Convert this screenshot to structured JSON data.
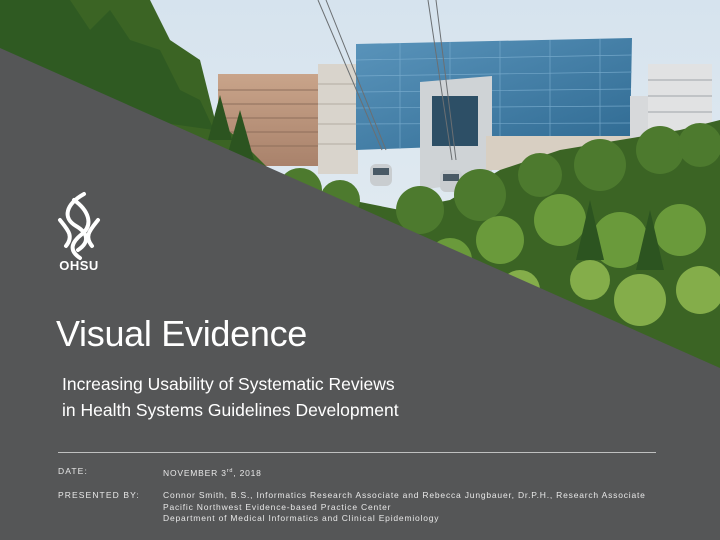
{
  "logo": {
    "wordmark": "OHSU"
  },
  "title": "Visual Evidence",
  "subtitle": {
    "line1": "Increasing Usability of Systematic Reviews",
    "line2": "in Health Systems Guidelines Development"
  },
  "date": {
    "label": "DATE:",
    "value_prefix": "NOVEMBER 3",
    "value_suffix": "rd",
    "value_year": ", 2018"
  },
  "presented": {
    "label": "PRESENTED BY:",
    "line1": "Connor Smith, B.S., Informatics Research Associate and Rebecca Jungbauer, Dr.P.H., Research Associate",
    "line2": "Pacific Northwest Evidence-based Practice Center",
    "line3": "Department of Medical Informatics and Clinical Epidemiology"
  },
  "colors": {
    "panel": "#555657",
    "text": "#ffffff",
    "sky": "#dfe9f1",
    "glass_building": "#3f7fa8",
    "foliage": "#3f6d2a"
  }
}
